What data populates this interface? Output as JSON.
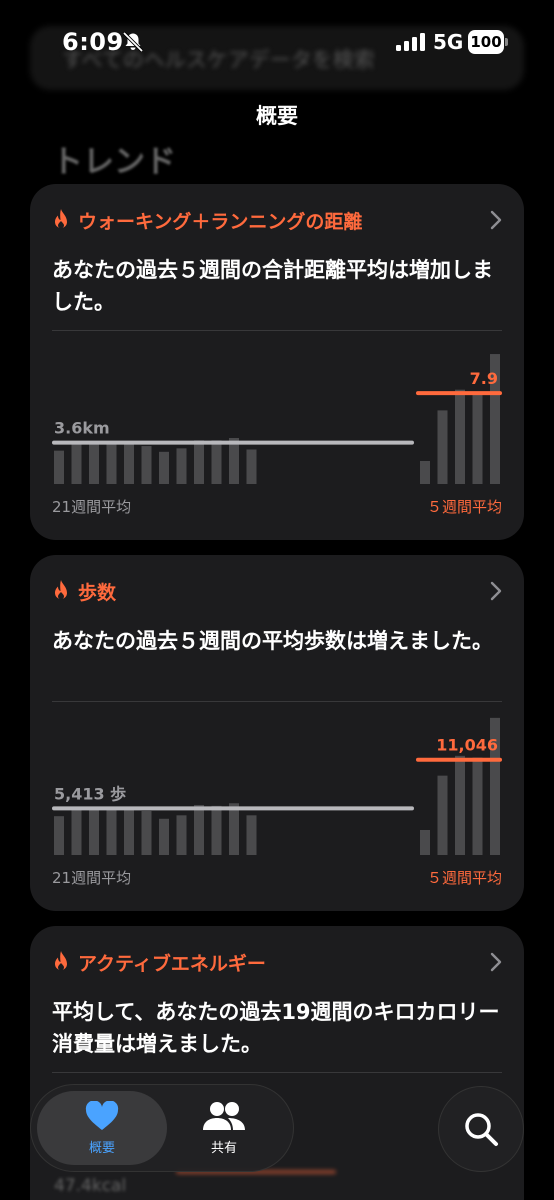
{
  "status": {
    "time": "6:09",
    "network": "5G",
    "battery": "100"
  },
  "search": {
    "placeholder": "すべてのヘルスケアデータを検索"
  },
  "nav": {
    "title": "概要"
  },
  "section": {
    "title": "トレンド"
  },
  "colors": {
    "accent": "#ff6a3d",
    "background": "#000000",
    "card": "#1c1c1e",
    "tab_active": "#4aa3ff"
  },
  "cards": [
    {
      "label": "ウォーキング＋ランニングの距離",
      "text": "あなたの過去５週間の合計距離平均は増加しました。",
      "chart_data": {
        "type": "bar",
        "avg21_label": "3.6km",
        "avg5_label": "7.9",
        "avg21": 3.6,
        "avg5": 7.9,
        "ylim": [
          0,
          12
        ],
        "weeks21_values": [
          2.9,
          3.6,
          3.7,
          3.6,
          3.6,
          3.3,
          2.8,
          3.1,
          3.8,
          3.8,
          4.0,
          3.0
        ],
        "weeks5_values": [
          2.0,
          6.4,
          8.2,
          8.0,
          11.3
        ],
        "footer_left": "21週間平均",
        "footer_right": "５週間平均"
      }
    },
    {
      "label": "歩数",
      "text": "あなたの過去５週間の平均歩数は増えました。",
      "chart_data": {
        "type": "bar",
        "avg21_label": "5,413 歩",
        "avg5_label": "11,046",
        "avg21": 5413,
        "avg5": 11046,
        "ylim": [
          0,
          16000
        ],
        "weeks21_values": [
          4500,
          5500,
          5600,
          5500,
          5500,
          5100,
          4200,
          4600,
          5800,
          5700,
          6000,
          4600
        ],
        "weeks5_values": [
          2900,
          9200,
          11500,
          11300,
          15900
        ],
        "footer_left": "21週間平均",
        "footer_right": "５週間平均"
      }
    },
    {
      "label": "アクティブエネルギー",
      "text": "平均して、あなたの過去19週間のキロカロリー消費量は増えました。"
    }
  ],
  "peek": {
    "label": "47.4kcal"
  },
  "tabs": [
    {
      "label": "概要",
      "icon": "heart-icon",
      "active": true
    },
    {
      "label": "共有",
      "icon": "people-icon",
      "active": false
    }
  ],
  "search_button": {
    "icon": "search-icon"
  }
}
